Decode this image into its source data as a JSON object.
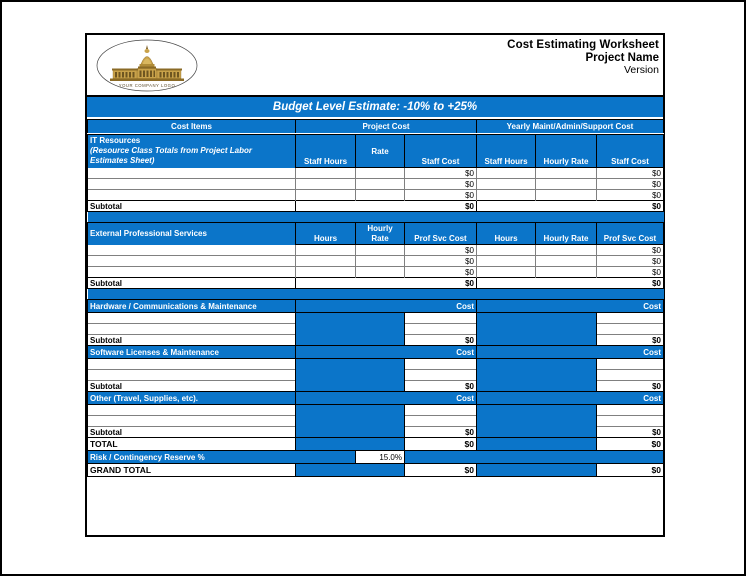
{
  "document": {
    "title_line1": "Cost Estimating Worksheet",
    "title_line2": "Project Name",
    "title_line3": "Version",
    "logo_text": "YOUR COMPANY LOGO",
    "logo_alt": "capitol-building-logo"
  },
  "banner": {
    "text": "Budget Level Estimate: -10% to +25%"
  },
  "top_headers": {
    "cost_items": "Cost Items",
    "project_cost": "Project Cost",
    "yearly_cost": "Yearly Maint/Admin/Support Cost"
  },
  "colors": {
    "accent_blue": "#0b75c9",
    "border_black": "#000000",
    "grid_gray": "#808080",
    "white": "#ffffff"
  },
  "labels": {
    "subtotal": "Subtotal",
    "total": "TOTAL",
    "grand_total": "GRAND TOTAL",
    "risk": "Risk / Contingency Reserve %",
    "zero": "$0",
    "blank": ""
  },
  "sections": [
    {
      "id": "it-resources",
      "name_line1": "IT Resources",
      "name_line2": "(Resource Class Totals from Project Labor",
      "name_line3": "Estimates Sheet)",
      "columns": {
        "project": [
          "Staff Hours",
          "Hourly Rate",
          "Staff Cost"
        ],
        "yearly": [
          "Staff Hours",
          "Hourly Rate",
          "Staff Cost"
        ]
      },
      "rows": [
        {
          "name": "",
          "p_hours": "",
          "p_rate": "",
          "p_cost": "$0",
          "y_hours": "",
          "y_rate": "",
          "y_cost": "$0"
        },
        {
          "name": "",
          "p_hours": "",
          "p_rate": "",
          "p_cost": "$0",
          "y_hours": "",
          "y_rate": "",
          "y_cost": "$0"
        },
        {
          "name": "",
          "p_hours": "",
          "p_rate": "",
          "p_cost": "$0",
          "y_hours": "",
          "y_rate": "",
          "y_cost": "$0"
        }
      ],
      "subtotal": {
        "label": "Subtotal",
        "p_cost": "$0",
        "y_cost": "$0"
      }
    },
    {
      "id": "external-professional-services",
      "name_line1": "External Professional Services",
      "columns": {
        "project": [
          "Hours",
          "Hourly Rate",
          "Prof Svc Cost"
        ],
        "yearly": [
          "Hours",
          "Hourly Rate",
          "Prof Svc Cost"
        ]
      },
      "rows": [
        {
          "name": "",
          "p_hours": "",
          "p_rate": "",
          "p_cost": "$0",
          "y_hours": "",
          "y_rate": "",
          "y_cost": "$0"
        },
        {
          "name": "",
          "p_hours": "",
          "p_rate": "",
          "p_cost": "$0",
          "y_hours": "",
          "y_rate": "",
          "y_cost": "$0"
        },
        {
          "name": "",
          "p_hours": "",
          "p_rate": "",
          "p_cost": "$0",
          "y_hours": "",
          "y_rate": "",
          "y_cost": "$0"
        }
      ],
      "subtotal": {
        "label": "Subtotal",
        "p_cost": "$0",
        "y_cost": "$0"
      }
    },
    {
      "id": "hardware-communications-maintenance",
      "name_line1": "Hardware / Communications & Maintenance",
      "columns": {
        "project": [
          "Cost"
        ],
        "yearly": [
          "Cost"
        ]
      },
      "rows": [
        {
          "name": "",
          "p_cost": "",
          "y_cost": ""
        },
        {
          "name": "",
          "p_cost": "",
          "y_cost": ""
        }
      ],
      "subtotal": {
        "label": "Subtotal",
        "p_cost": "$0",
        "y_cost": "$0"
      }
    },
    {
      "id": "software-licenses-maintenance",
      "name_line1": "Software Licenses & Maintenance",
      "columns": {
        "project": [
          "Cost"
        ],
        "yearly": [
          "Cost"
        ]
      },
      "rows": [
        {
          "name": "",
          "p_cost": "",
          "y_cost": ""
        },
        {
          "name": "",
          "p_cost": "",
          "y_cost": ""
        }
      ],
      "subtotal": {
        "label": "Subtotal",
        "p_cost": "$0",
        "y_cost": "$0"
      }
    },
    {
      "id": "other-travel-supplies",
      "name_line1": "Other (Travel, Supplies, etc).",
      "columns": {
        "project": [
          "Cost"
        ],
        "yearly": [
          "Cost"
        ]
      },
      "rows": [
        {
          "name": "",
          "p_cost": "",
          "y_cost": ""
        },
        {
          "name": "",
          "p_cost": "",
          "y_cost": ""
        }
      ],
      "subtotal": {
        "label": "Subtotal",
        "p_cost": "$0",
        "y_cost": "$0"
      }
    }
  ],
  "totals": {
    "total": {
      "label": "TOTAL",
      "p_cost": "$0",
      "y_cost": "$0"
    },
    "risk": {
      "label": "Risk / Contingency Reserve %",
      "value": "15.0%"
    },
    "grand_total": {
      "label": "GRAND TOTAL",
      "p_cost": "$0",
      "y_cost": "$0"
    }
  }
}
